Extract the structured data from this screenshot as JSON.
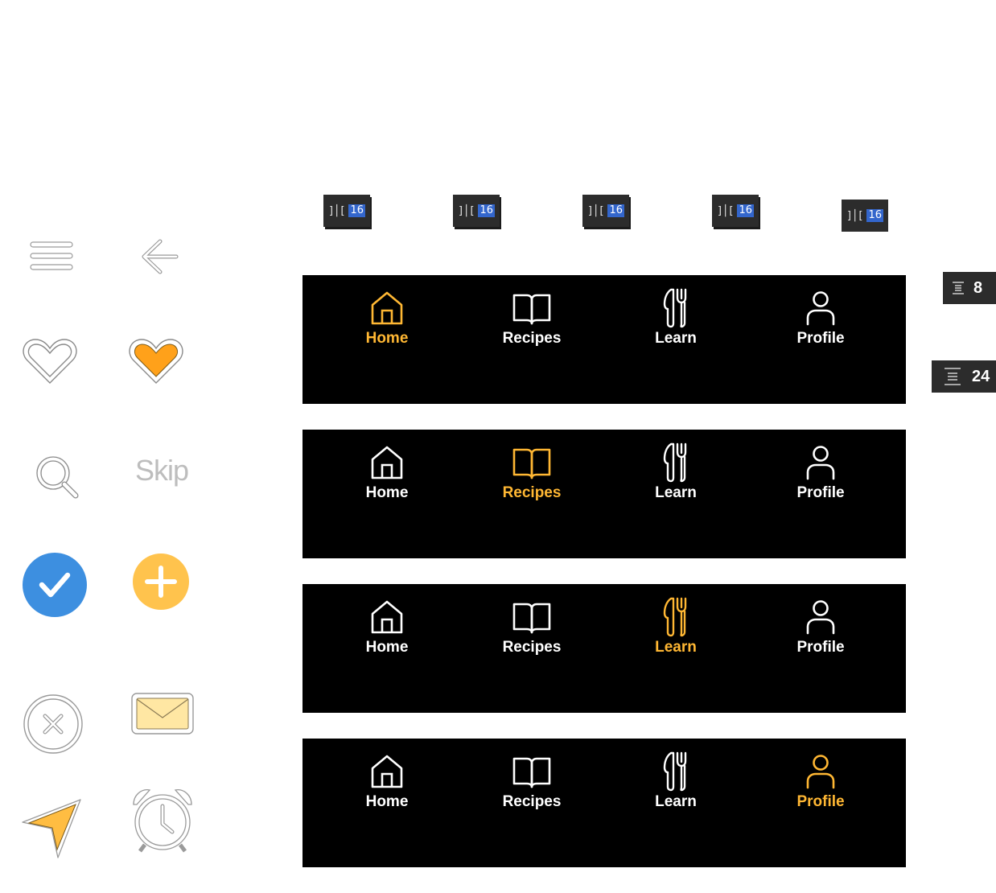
{
  "colors": {
    "active": "#ffb733",
    "inactive": "#ffffff",
    "bar_bg": "#000000",
    "check_blue": "#3d8fe0",
    "plus_orange": "#ffc34d"
  },
  "spacing_badges": [
    {
      "glyph": "]│[",
      "value": "16"
    },
    {
      "glyph": "]│[",
      "value": "16"
    },
    {
      "glyph": "]│[",
      "value": "16"
    },
    {
      "glyph": "]│[",
      "value": "16"
    },
    {
      "glyph": "]│[",
      "value": "16"
    }
  ],
  "gap_badges": [
    {
      "value": "8"
    },
    {
      "value": "24"
    }
  ],
  "left_icons": {
    "skip_label": "Skip",
    "icons": [
      "menu-icon",
      "arrow-left-icon",
      "heart-outline-icon",
      "heart-filled-icon",
      "search-icon",
      "skip-text",
      "check-circle-icon",
      "plus-circle-icon",
      "close-circle-icon",
      "mail-icon",
      "send-icon",
      "alarm-icon"
    ]
  },
  "tab_bars": [
    {
      "active": "home",
      "tabs": [
        {
          "id": "home",
          "label": "Home",
          "icon": "home-icon"
        },
        {
          "id": "recipes",
          "label": "Recipes",
          "icon": "book-icon"
        },
        {
          "id": "learn",
          "label": "Learn",
          "icon": "cutlery-icon"
        },
        {
          "id": "profile",
          "label": "Profile",
          "icon": "user-icon"
        }
      ]
    },
    {
      "active": "recipes",
      "tabs": [
        {
          "id": "home",
          "label": "Home",
          "icon": "home-icon"
        },
        {
          "id": "recipes",
          "label": "Recipes",
          "icon": "book-icon"
        },
        {
          "id": "learn",
          "label": "Learn",
          "icon": "cutlery-icon"
        },
        {
          "id": "profile",
          "label": "Profile",
          "icon": "user-icon"
        }
      ]
    },
    {
      "active": "learn",
      "tabs": [
        {
          "id": "home",
          "label": "Home",
          "icon": "home-icon"
        },
        {
          "id": "recipes",
          "label": "Recipes",
          "icon": "book-icon"
        },
        {
          "id": "learn",
          "label": "Learn",
          "icon": "cutlery-icon"
        },
        {
          "id": "profile",
          "label": "Profile",
          "icon": "user-icon"
        }
      ]
    },
    {
      "active": "profile",
      "tabs": [
        {
          "id": "home",
          "label": "Home",
          "icon": "home-icon"
        },
        {
          "id": "recipes",
          "label": "Recipes",
          "icon": "book-icon"
        },
        {
          "id": "learn",
          "label": "Learn",
          "icon": "cutlery-icon"
        },
        {
          "id": "profile",
          "label": "Profile",
          "icon": "user-icon"
        }
      ]
    }
  ]
}
